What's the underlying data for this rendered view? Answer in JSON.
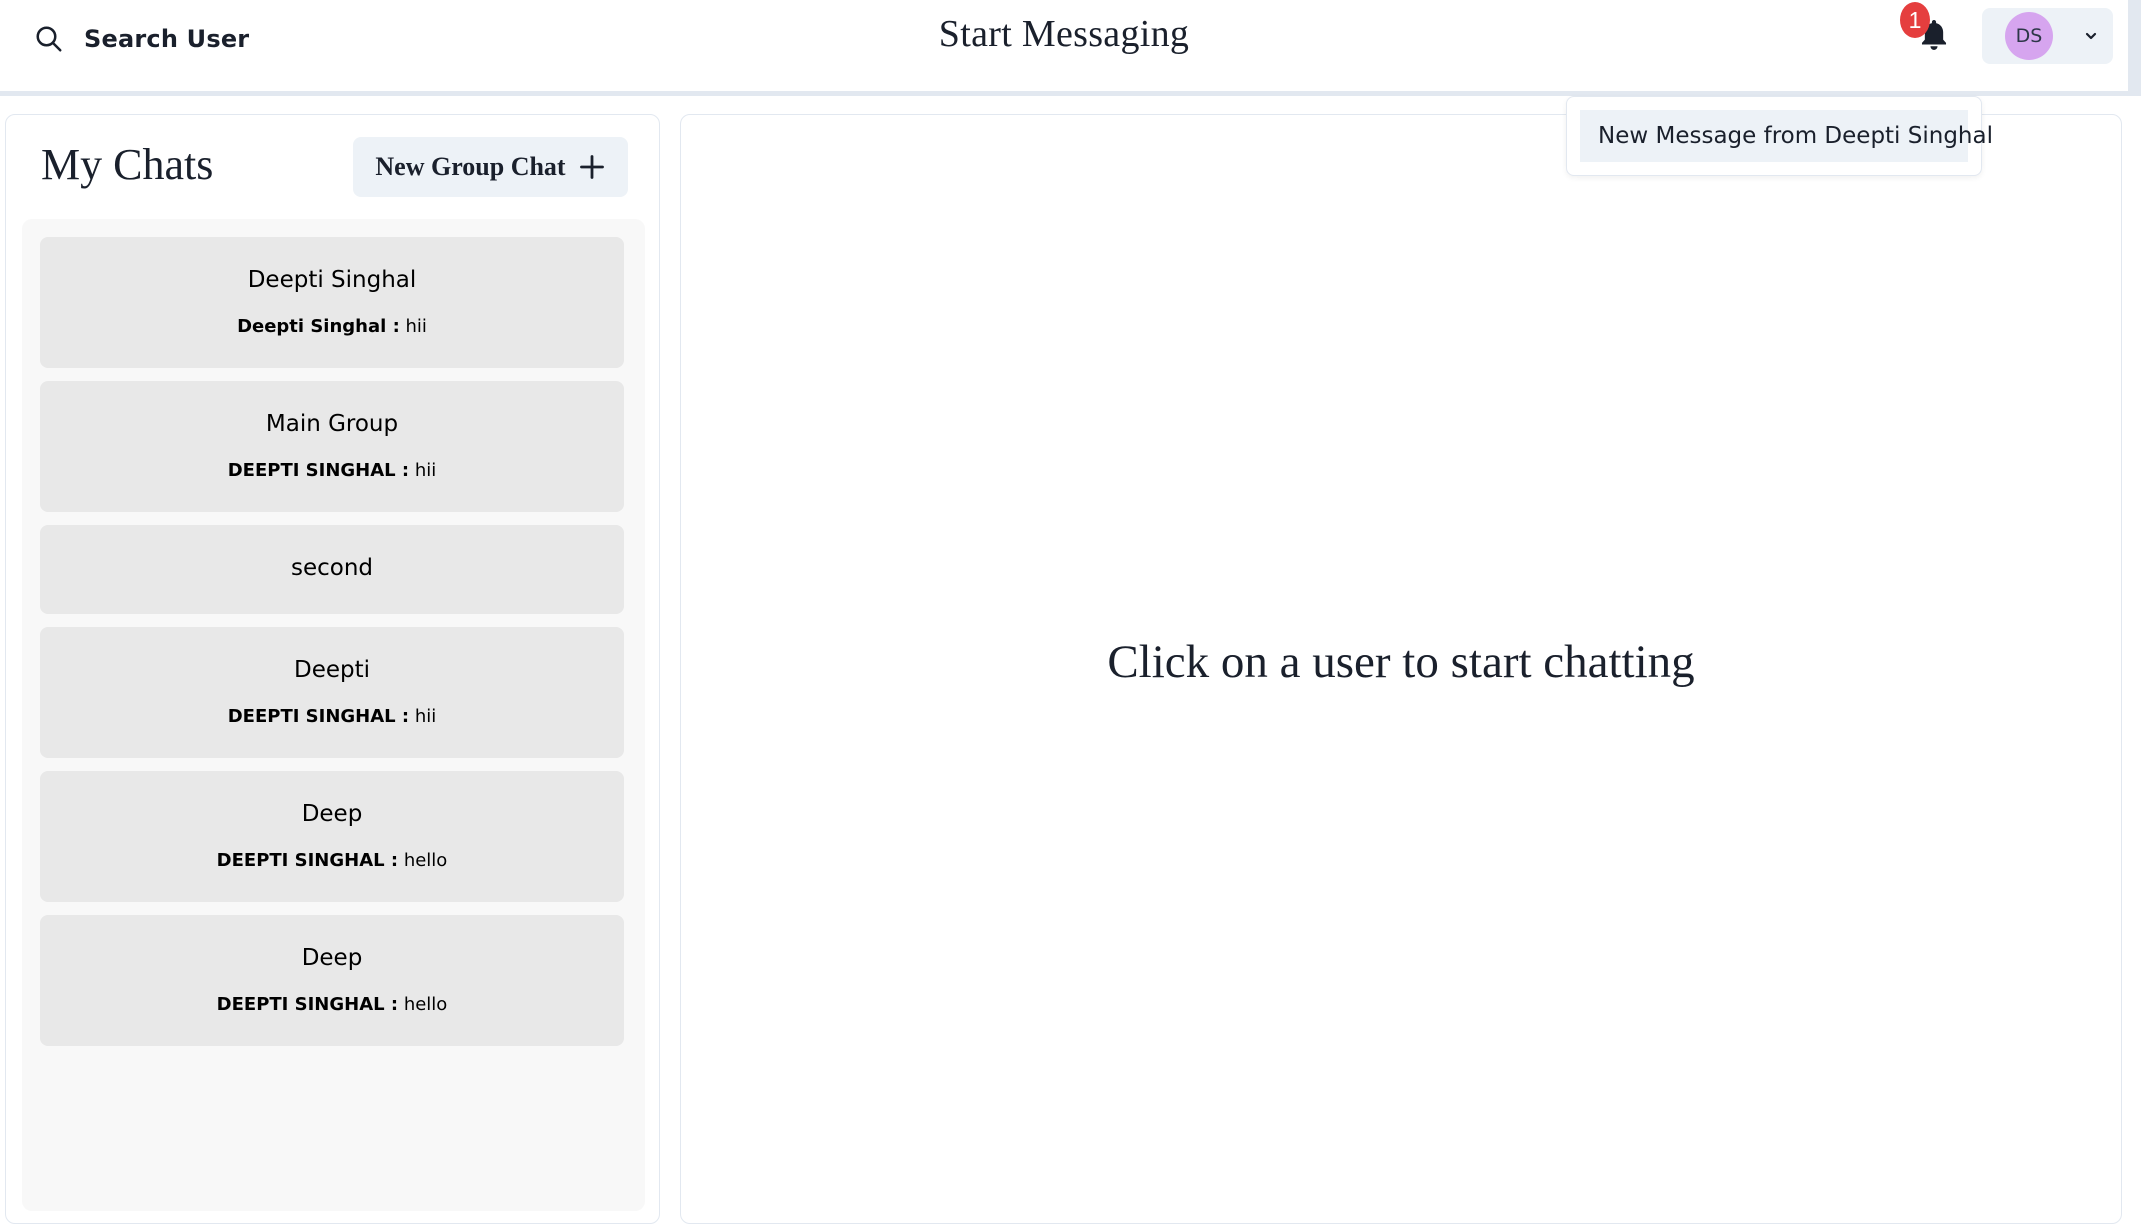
{
  "header": {
    "search_label": "Search User",
    "title": "Start Messaging",
    "notification_count": "1",
    "avatar_initials": "DS"
  },
  "notifications": {
    "items": [
      {
        "label": "New Message from Deepti Singhal"
      }
    ]
  },
  "sidebar": {
    "title": "My Chats",
    "new_group_label": "New Group Chat",
    "chats": [
      {
        "name": "Deepti Singhal",
        "sender": "Deepti Singhal :",
        "message": "hii"
      },
      {
        "name": "Main Group",
        "sender": "DEEPTI SINGHAL :",
        "message": "hii"
      },
      {
        "name": "second",
        "sender": "",
        "message": ""
      },
      {
        "name": "Deepti",
        "sender": "DEEPTI SINGHAL :",
        "message": "hii"
      },
      {
        "name": "Deep",
        "sender": "DEEPTI SINGHAL :",
        "message": "hello"
      },
      {
        "name": "Deep",
        "sender": "DEEPTI SINGHAL :",
        "message": "hello"
      }
    ]
  },
  "main": {
    "empty_message": "Click on a user to start chatting"
  },
  "colors": {
    "badge": "#e53e3e",
    "avatar_bg": "#d6a5ef",
    "button_bg": "#edf2f7",
    "chat_card_bg": "#e8e8e8"
  }
}
